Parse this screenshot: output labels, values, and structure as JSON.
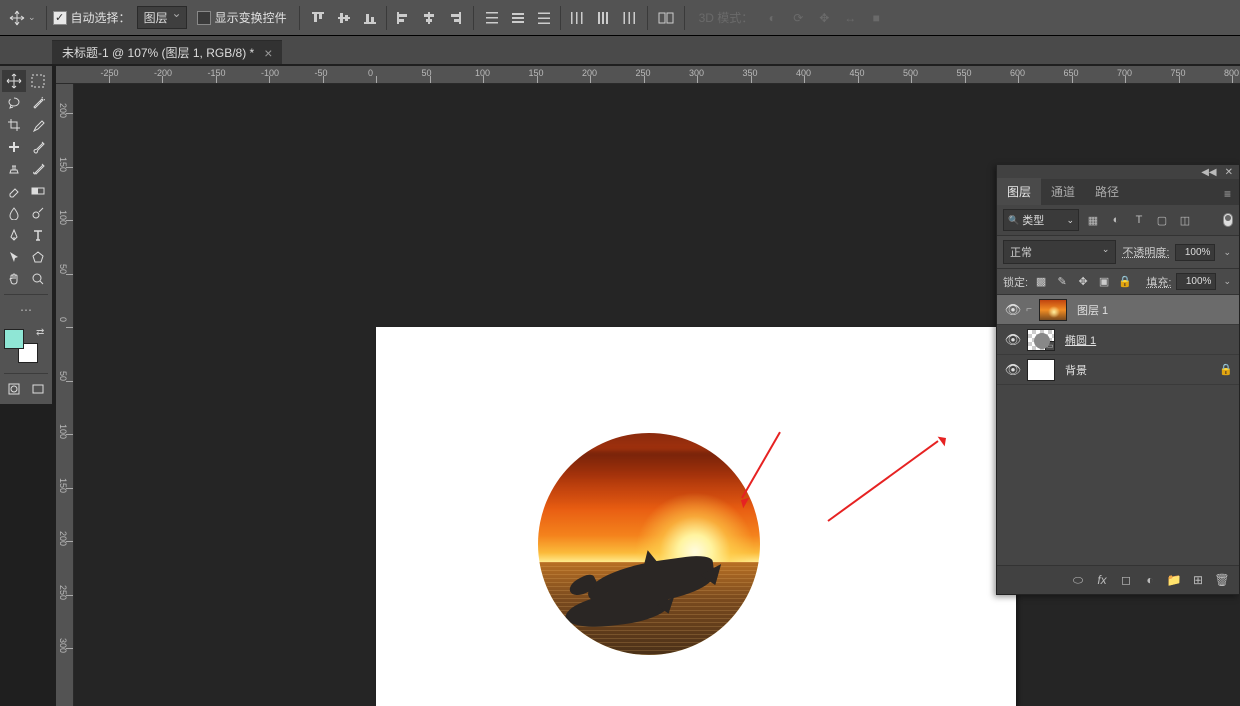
{
  "options_bar": {
    "auto_select_label": "自动选择：",
    "auto_select_value": "图层",
    "show_transform_label": "显示变换控件",
    "mode3d_label": "3D 模式："
  },
  "doc_tab": {
    "title": "未标题-1 @ 107% (图层 1, RGB/8) *"
  },
  "ruler_h_ticks": [
    -250,
    -200,
    -150,
    -100,
    -50,
    0,
    50,
    100,
    150,
    200,
    250,
    300,
    350,
    400,
    450,
    500,
    550,
    600,
    650,
    700,
    750,
    800
  ],
  "ruler_v_ticks": [
    -200,
    -150,
    -100,
    -50,
    0,
    50,
    100,
    150,
    200,
    250,
    300
  ],
  "layers_panel": {
    "tabs": {
      "layers": "图层",
      "channels": "通道",
      "paths": "路径"
    },
    "filter_kind": "类型",
    "blend_mode": "正常",
    "opacity_label": "不透明度:",
    "opacity_value": "100%",
    "lock_label": "锁定:",
    "fill_label": "填充:",
    "fill_value": "100%",
    "layers": [
      {
        "name": "图层 1",
        "selected": true,
        "thumb": "sunset",
        "mask": true
      },
      {
        "name": "椭圆 1",
        "selected": false,
        "thumb": "ellipse",
        "underlined": true
      },
      {
        "name": "背景",
        "selected": false,
        "thumb": "white",
        "locked": true
      }
    ]
  },
  "swatches": {
    "fg": "#8fe6d5",
    "bg": "#ffffff"
  }
}
